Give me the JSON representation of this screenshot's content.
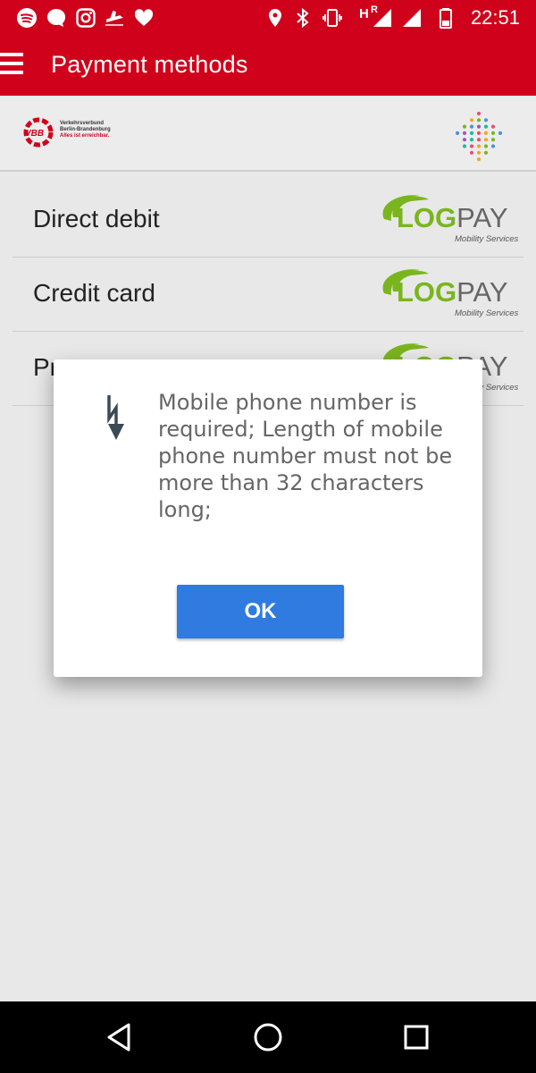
{
  "status_bar": {
    "time": "22:51",
    "network_label": "R",
    "left_icons": [
      "spotify-icon",
      "message-icon",
      "instagram-icon",
      "flight-icon",
      "heart-icon"
    ],
    "right_icons": [
      "location-icon",
      "bluetooth-icon",
      "vibrate-icon",
      "signal-icon",
      "signal-icon",
      "battery-icon"
    ]
  },
  "app_bar": {
    "title": "Payment methods"
  },
  "header": {
    "vbb_logo": {
      "mark": "VBB",
      "line1": "Verkehrsverbund",
      "line2": "Berlin-Brandenburg",
      "tagline": "Alles ist erreichbar."
    }
  },
  "payment_methods": [
    {
      "label": "Direct debit",
      "provider": "LOGPAY",
      "provider_sub": "Mobility Services"
    },
    {
      "label": "Credit card",
      "provider": "LOGPAY",
      "provider_sub": "Mobility Services"
    },
    {
      "label": "Pr",
      "provider": "LOGPAY",
      "provider_sub": "Mobility Services"
    }
  ],
  "dialog": {
    "icon": "error-icon",
    "message": "Mobile phone number is required; Length of mobile phone number must not be more than 32 characters long;",
    "ok_label": "OK"
  },
  "colors": {
    "brand_red": "#d0021b",
    "ok_blue": "#2f7be0",
    "logpay_green": "#7ab51d"
  }
}
